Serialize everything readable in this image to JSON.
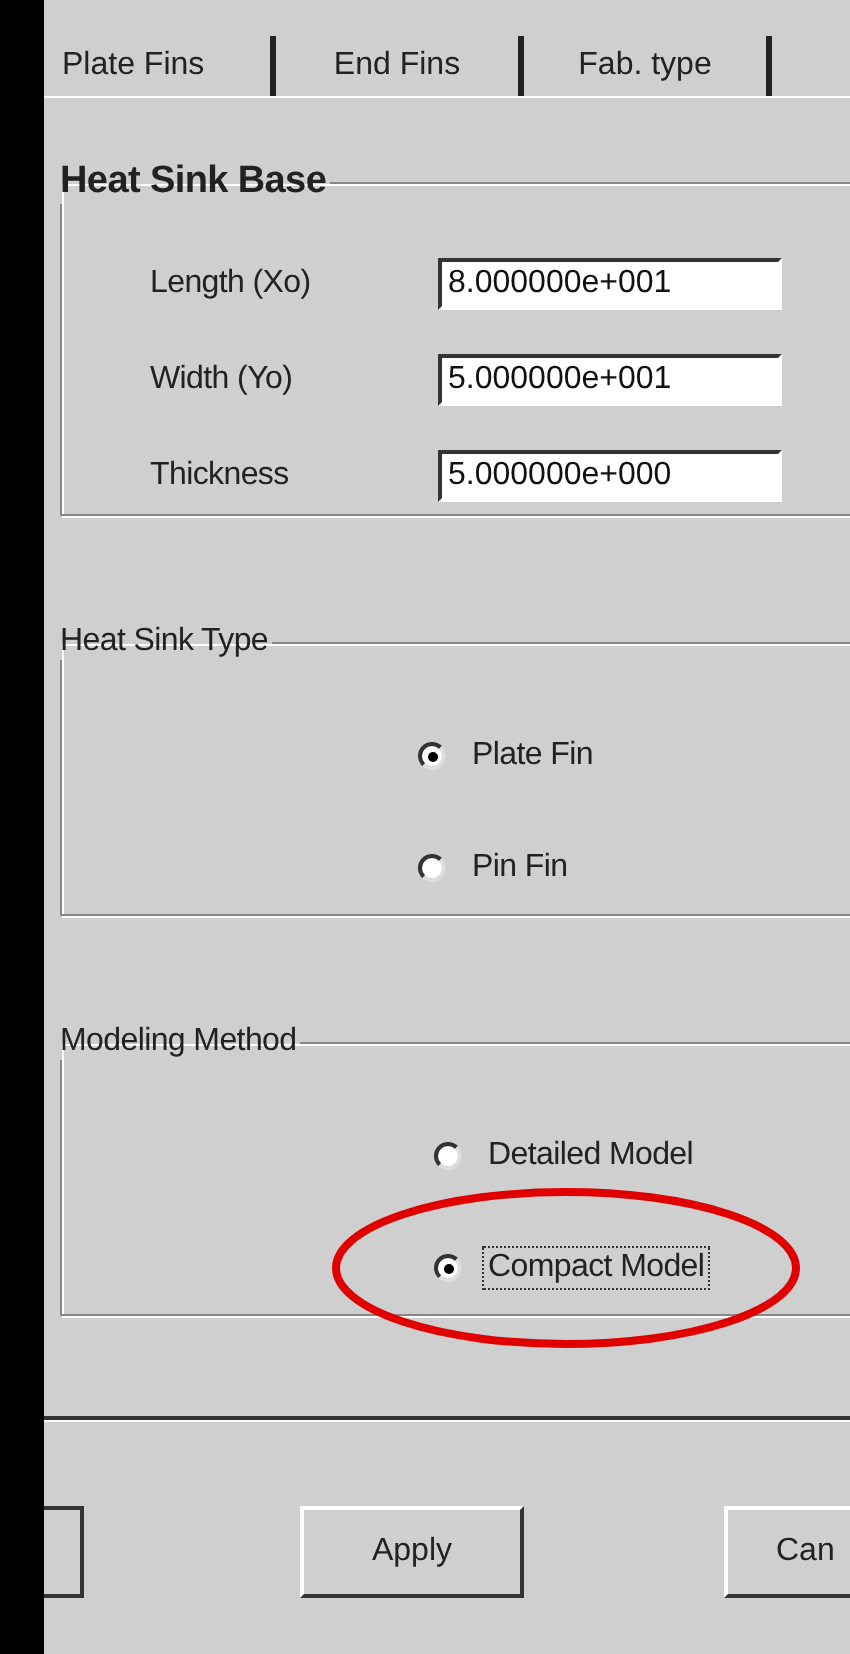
{
  "tabs": [
    {
      "label": "Plate Fins",
      "selected": false
    },
    {
      "label": "End Fins",
      "selected": false
    },
    {
      "label": "Fab. type",
      "selected": false
    }
  ],
  "heat_sink_base": {
    "title": "Heat Sink Base",
    "fields": [
      {
        "label": "Length (Xo)",
        "value": "8.000000e+001"
      },
      {
        "label": "Width (Yo)",
        "value": "5.000000e+001"
      },
      {
        "label": "Thickness",
        "value": "5.000000e+000"
      }
    ]
  },
  "heat_sink_type": {
    "title": "Heat Sink Type",
    "options": [
      {
        "label": "Plate Fin",
        "selected": true,
        "focused": false
      },
      {
        "label": "Pin Fin",
        "selected": false,
        "focused": false
      }
    ]
  },
  "modeling_method": {
    "title": "Modeling Method",
    "options": [
      {
        "label": "Detailed Model",
        "selected": false,
        "focused": false,
        "circled": false
      },
      {
        "label": "Compact Model",
        "selected": true,
        "focused": true,
        "circled": true
      }
    ]
  },
  "buttons": [
    "Apply",
    "Can"
  ]
}
